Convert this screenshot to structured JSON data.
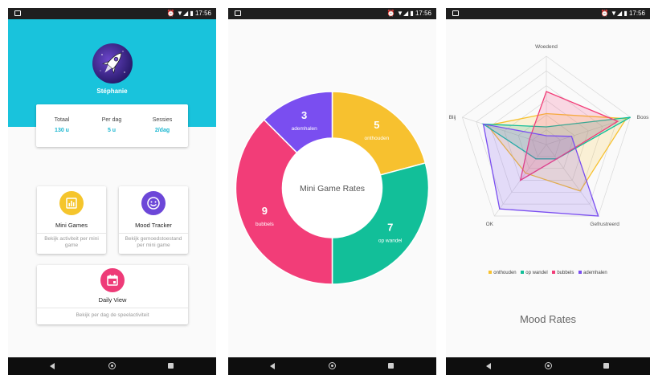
{
  "statusbar": {
    "time": "17:56",
    "icons": "⏰ ▼◢ ▮"
  },
  "profile": {
    "username": "Stéphanie",
    "stats": [
      {
        "label": "Totaal",
        "value": "130 u"
      },
      {
        "label": "Per dag",
        "value": "5 u"
      },
      {
        "label": "Sessies",
        "value": "2/dag"
      }
    ]
  },
  "tiles": [
    {
      "title": "Mini Games",
      "description": "Bekijk activiteit per mini game",
      "icon": "bar-chart-icon",
      "color": "#f5c52c"
    },
    {
      "title": "Mood Tracker",
      "description": "Bekijk gemoedstoestand per mini game",
      "icon": "smiley-icon",
      "color": "#6c47d8"
    },
    {
      "title": "Daily View",
      "description": "Bekijk per dag de speelactiviteit",
      "icon": "calendar-icon",
      "color": "#ee3b78"
    }
  ],
  "chart_data": [
    {
      "type": "pie",
      "title": "Mini Game Rates",
      "categories": [
        "onthouden",
        "op wandel",
        "bubbels",
        "ademhalen"
      ],
      "values": [
        5,
        7,
        9,
        3
      ],
      "colors": [
        "#f7c12f",
        "#12bf99",
        "#f23d78",
        "#7a4ef0"
      ]
    },
    {
      "type": "radar",
      "title": "Mood Rates",
      "axes": [
        "Woedend",
        "Boos",
        "Gefrustreerd",
        "OK",
        "Blij"
      ],
      "legend_position": "bottom",
      "series": [
        {
          "name": "onthouden",
          "color": "#f7c12f",
          "values": [
            0.35,
            0.95,
            0.65,
            0.4,
            0.7
          ]
        },
        {
          "name": "op wandel",
          "color": "#12bf99",
          "values": [
            0.2,
            1.0,
            0.2,
            0.2,
            0.75
          ]
        },
        {
          "name": "bubbels",
          "color": "#f23d78",
          "values": [
            0.6,
            0.85,
            0.2,
            0.5,
            0.2
          ]
        },
        {
          "name": "ademhalen",
          "color": "#7a4ef0",
          "values": [
            0.1,
            0.3,
            1.0,
            0.9,
            0.75
          ]
        }
      ]
    }
  ],
  "nav": {
    "back": "◀",
    "home": "●",
    "recent": "■"
  }
}
